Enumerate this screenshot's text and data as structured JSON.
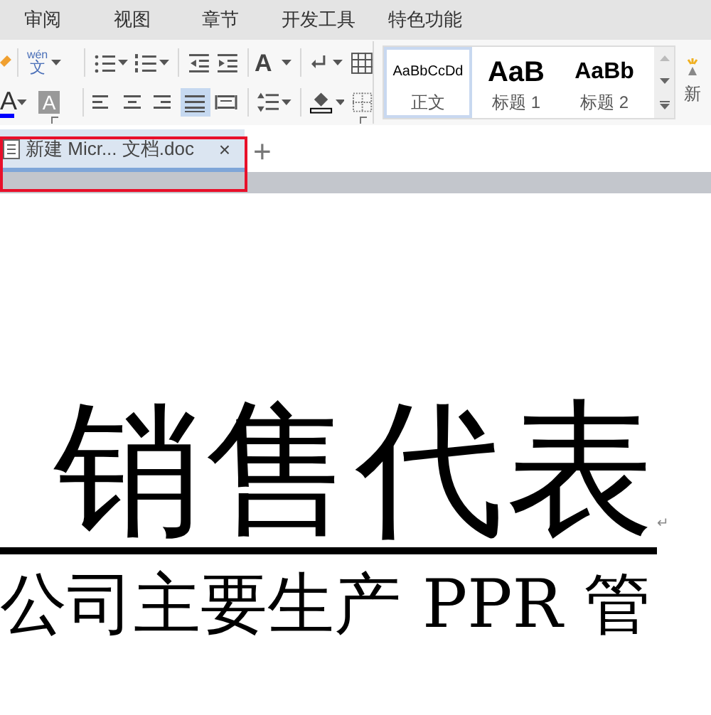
{
  "menu_tabs": [
    {
      "label": "审阅"
    },
    {
      "label": "视图"
    },
    {
      "label": "章节"
    },
    {
      "label": "开发工具"
    },
    {
      "label": "特色功能"
    }
  ],
  "toolbar": {
    "pinyin_top": "wén",
    "pinyin_bottom": "文",
    "font_grow": "A",
    "font_color": "A",
    "highlight": "A",
    "align_buttons": [
      {
        "kind": "left",
        "selected": false
      },
      {
        "kind": "center",
        "selected": false
      },
      {
        "kind": "right",
        "selected": false
      },
      {
        "kind": "justify",
        "selected": true
      },
      {
        "kind": "distributed",
        "selected": false
      }
    ]
  },
  "styles": [
    {
      "preview": "AaBbCcDd",
      "label": "正文",
      "kind": "body",
      "selected": true
    },
    {
      "preview": "AaB",
      "label": "标题 1",
      "kind": "h1",
      "selected": false
    },
    {
      "preview": "AaBb",
      "label": "标题 2",
      "kind": "h2",
      "selected": false
    }
  ],
  "new_style_label": "新",
  "document_tab": {
    "title": "新建 Micr... 文档.doc",
    "close": "×",
    "highlighted": true
  },
  "new_tab": "+",
  "document": {
    "title": "销售代表",
    "paragraph_mark": "↵",
    "body": "公司主要生产 PPR 管"
  }
}
